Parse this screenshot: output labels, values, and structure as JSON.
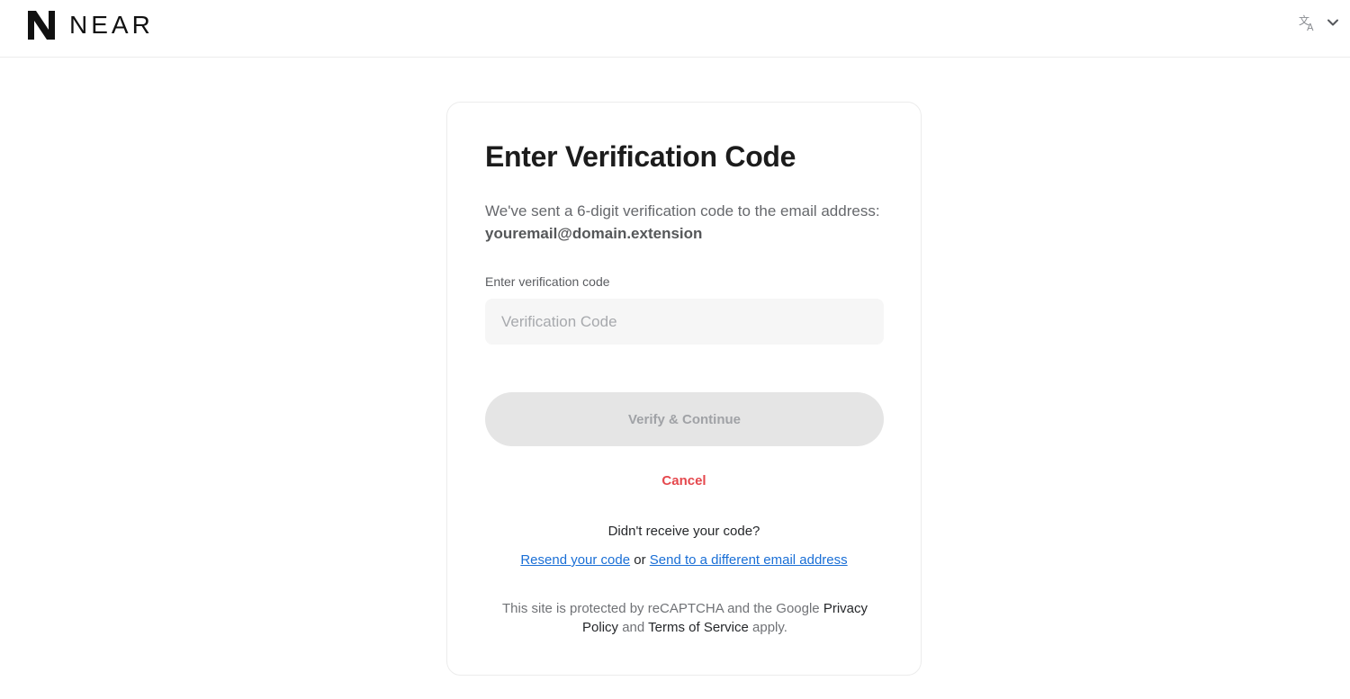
{
  "header": {
    "brand": "NEAR",
    "logo_icon": "near-logo-icon",
    "language_icon": "translate-icon",
    "dropdown_icon": "chevron-down-icon"
  },
  "card": {
    "title": "Enter Verification Code",
    "description_prefix": "We've sent a 6-digit verification code to the email address:",
    "email": "youremail@domain.extension",
    "input_label": "Enter verification code",
    "input_value": "",
    "input_placeholder": "Verification Code",
    "verify_button": "Verify & Continue",
    "cancel_link": "Cancel",
    "resend_question": "Didn't receive your code?",
    "resend_link": "Resend your code",
    "or_text": "or",
    "different_email_link": "Send to a different email address",
    "recaptcha_prefix": "This site is protected by reCAPTCHA and the Google",
    "privacy_link": "Privacy Policy",
    "and_text": "and",
    "terms_link": "Terms of Service",
    "apply_text": "apply."
  },
  "colors": {
    "cancel": "#e5484d",
    "link": "#1a6fd6",
    "button_disabled_bg": "#e5e5e5",
    "input_bg": "#f6f6f6"
  }
}
